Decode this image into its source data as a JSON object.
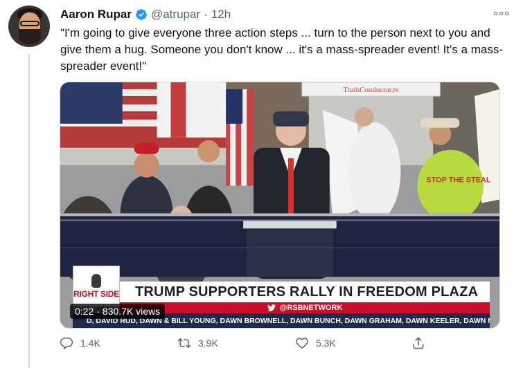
{
  "tweet": {
    "author": {
      "display_name": "Aaron Rupar",
      "handle": "@atrupar",
      "verified": true
    },
    "separator": "·",
    "timestamp": "12h",
    "text": "\"I'm going to give everyone three action steps ... turn to the person next to you and give them a hug. Someone you don't know ... it's a mass-spreader event! It's a mass-spreader event!\"",
    "media": {
      "type": "video",
      "signs": {
        "truth_conductor": "TruthConductor.tv",
        "stop_steal": "STOP THE STEAL"
      },
      "chyron": {
        "logo_text": "RIGHT SIDE",
        "headline": "TRUMP SUPPORTERS RALLY IN FREEDOM PLAZA",
        "subline": "@RSBNETWORK",
        "ticker": "D, DAVID RUD, DAWN & BILL YOUNG, DAWN BROWNELL, DAWN BUNCH, DAWN GRAHAM, DAWN KEELER, DAWN MARIE O"
      },
      "duration": "0:22",
      "separator": "·",
      "views": "830.7K views"
    },
    "actions": {
      "reply_count": "1.4K",
      "retweet_count": "3.9K",
      "like_count": "5.3K"
    }
  },
  "colors": {
    "text_primary": "#0f1419",
    "text_secondary": "#536471",
    "verified_blue": "#1d9bf0",
    "chyron_red": "#c8102e",
    "ticker_navy": "#1f2b4d"
  },
  "icons": [
    "verified-badge-icon",
    "more-options-icon",
    "play-icon",
    "reply-icon",
    "retweet-icon",
    "like-icon",
    "share-icon",
    "twitter-bird-icon"
  ]
}
